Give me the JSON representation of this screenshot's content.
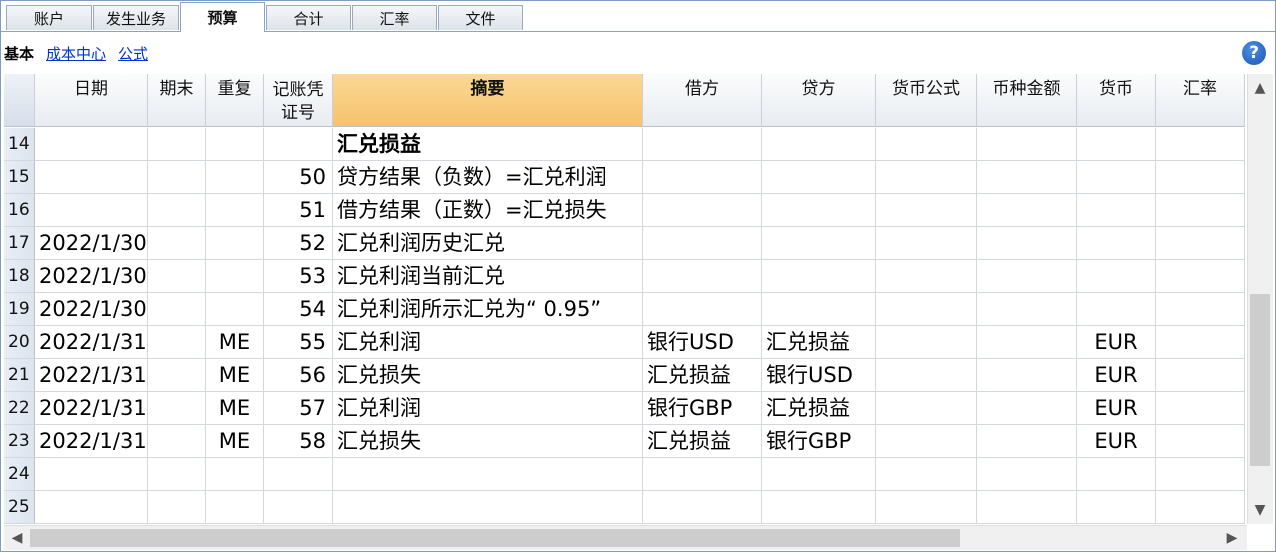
{
  "tabs": [
    {
      "label": "账户",
      "active": false
    },
    {
      "label": "发生业务",
      "active": false
    },
    {
      "label": "预算",
      "active": true
    },
    {
      "label": "合计",
      "active": false
    },
    {
      "label": "汇率",
      "active": false
    },
    {
      "label": "文件",
      "active": false
    }
  ],
  "subviews": {
    "current": "基本",
    "links": [
      "成本中心",
      "公式"
    ]
  },
  "help_icon": "?",
  "columns": {
    "date": "日期",
    "period_end": "期末",
    "repeat": "重复",
    "voucher_line1": "记账凭",
    "voucher_line2": "证号",
    "description": "摘要",
    "debit": "借方",
    "credit": "贷方",
    "currency_formula": "货币公式",
    "currency_amount": "币种金额",
    "currency": "货币",
    "exchange_rate": "汇率"
  },
  "rows": [
    {
      "n": "14",
      "date": "",
      "end": "",
      "repeat": "",
      "voucher": "",
      "desc": "汇兑损益",
      "debit": "",
      "credit": "",
      "cur": "",
      "bold": true
    },
    {
      "n": "15",
      "date": "",
      "end": "",
      "repeat": "",
      "voucher": "50",
      "desc": "贷方结果（负数）=汇兑利润",
      "debit": "",
      "credit": "",
      "cur": ""
    },
    {
      "n": "16",
      "date": "",
      "end": "",
      "repeat": "",
      "voucher": "51",
      "desc": "借方结果（正数）=汇兑损失",
      "debit": "",
      "credit": "",
      "cur": ""
    },
    {
      "n": "17",
      "date": "2022/1/30",
      "end": "",
      "repeat": "",
      "voucher": "52",
      "desc": "汇兑利润历史汇兑",
      "debit": "",
      "credit": "",
      "cur": ""
    },
    {
      "n": "18",
      "date": "2022/1/30",
      "end": "",
      "repeat": "",
      "voucher": "53",
      "desc": "汇兑利润当前汇兑",
      "debit": "",
      "credit": "",
      "cur": ""
    },
    {
      "n": "19",
      "date": "2022/1/30",
      "end": "",
      "repeat": "",
      "voucher": "54",
      "desc": "汇兑利润所示汇兑为“ 0.95”",
      "debit": "",
      "credit": "",
      "cur": ""
    },
    {
      "n": "20",
      "date": "2022/1/31",
      "end": "",
      "repeat": "ME",
      "voucher": "55",
      "desc": "汇兑利润",
      "debit": "银行USD",
      "credit": "汇兑损益",
      "cur": "EUR"
    },
    {
      "n": "21",
      "date": "2022/1/31",
      "end": "",
      "repeat": "ME",
      "voucher": "56",
      "desc": "汇兑损失",
      "debit": "汇兑损益",
      "credit": "银行USD",
      "cur": "EUR"
    },
    {
      "n": "22",
      "date": "2022/1/31",
      "end": "",
      "repeat": "ME",
      "voucher": "57",
      "desc": "汇兑利润",
      "debit": "银行GBP",
      "credit": "汇兑损益",
      "cur": "EUR"
    },
    {
      "n": "23",
      "date": "2022/1/31",
      "end": "",
      "repeat": "ME",
      "voucher": "58",
      "desc": "汇兑损失",
      "debit": "汇兑损益",
      "credit": "银行GBP",
      "cur": "EUR"
    },
    {
      "n": "24",
      "date": "",
      "end": "",
      "repeat": "",
      "voucher": "",
      "desc": "",
      "debit": "",
      "credit": "",
      "cur": ""
    },
    {
      "n": "25",
      "date": "",
      "end": "",
      "repeat": "",
      "voucher": "",
      "desc": "",
      "debit": "",
      "credit": "",
      "cur": ""
    }
  ],
  "scroll_arrows": {
    "up": "▲",
    "down": "▼",
    "left": "◀",
    "right": "▶"
  }
}
